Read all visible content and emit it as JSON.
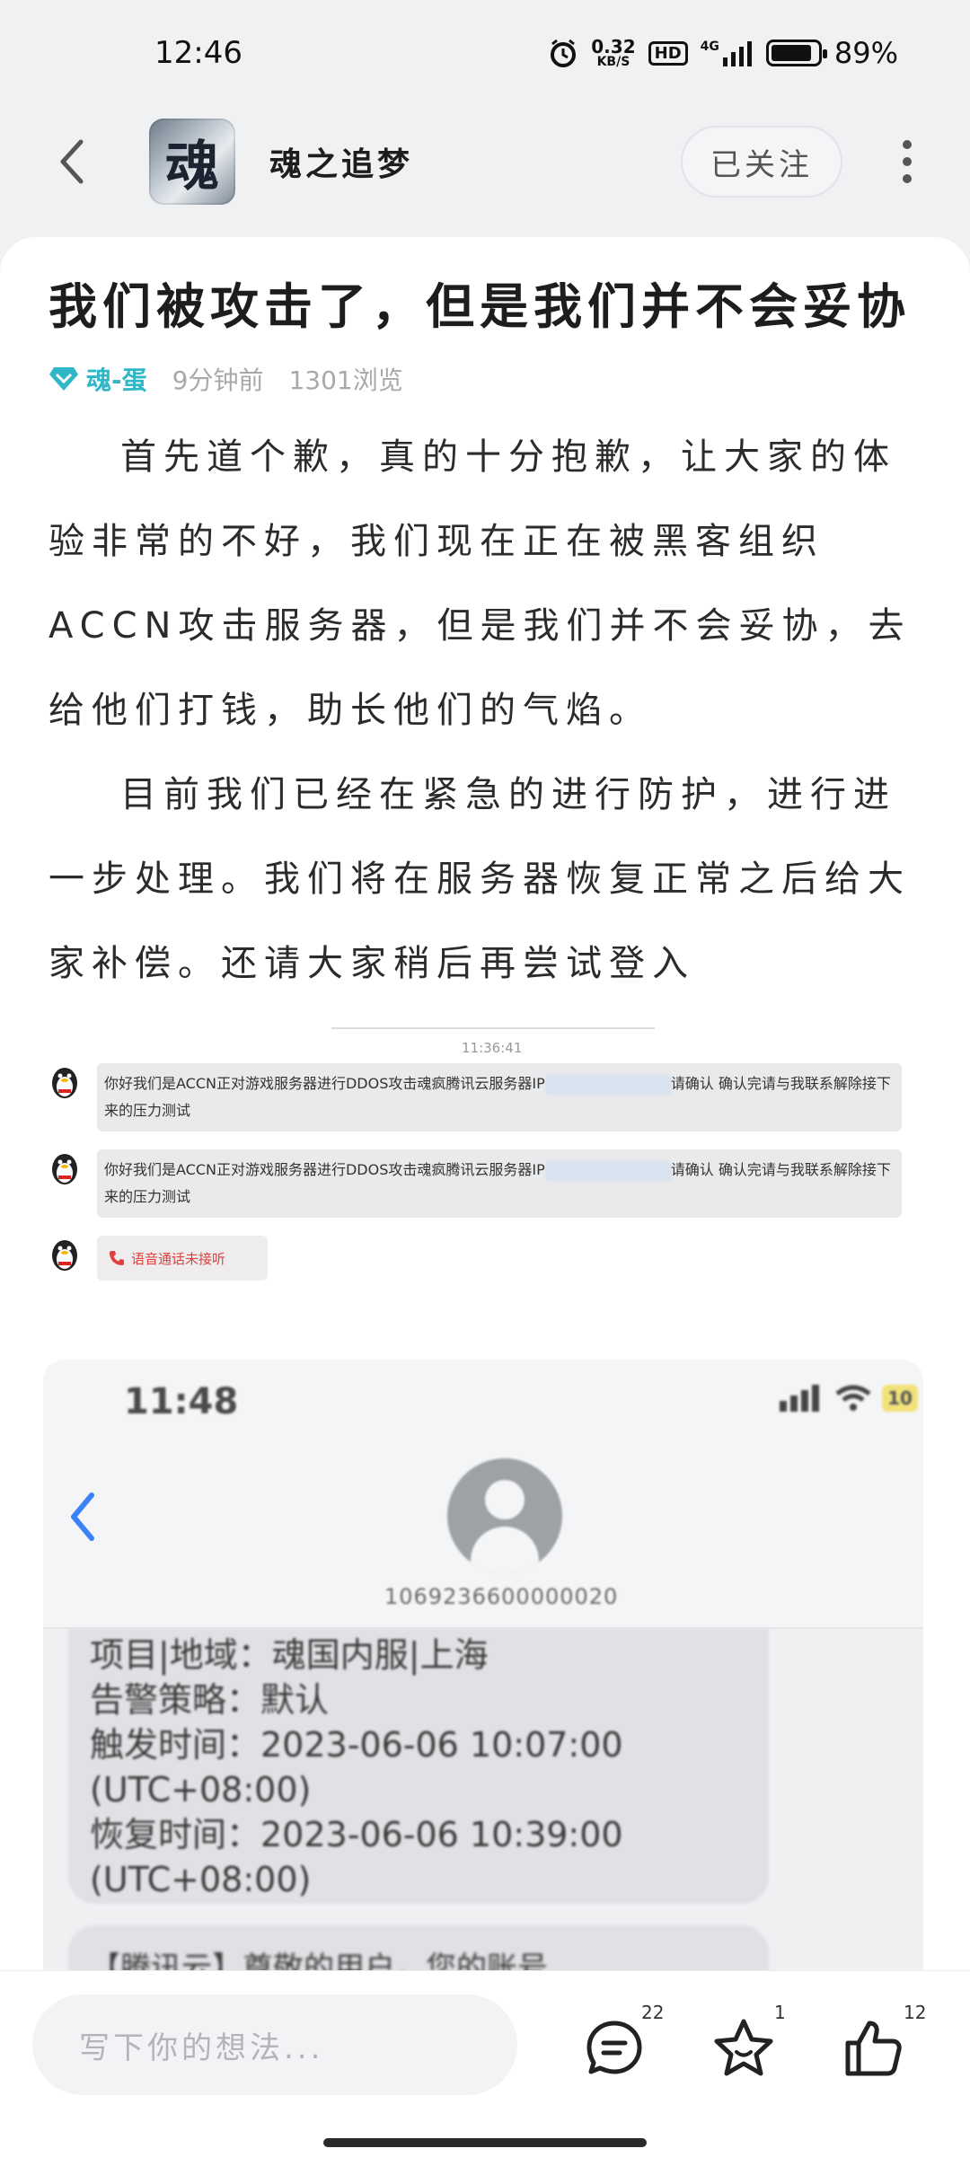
{
  "status_bar": {
    "time": "12:46",
    "net_speed_value": "0.32",
    "net_speed_unit": "KB/S",
    "hd_label": "HD",
    "network_label": "4G",
    "battery_percent": "89%",
    "battery_level": 0.89,
    "icons": [
      "alarm-icon",
      "signal-icon",
      "battery-icon"
    ]
  },
  "header": {
    "app_logo_char": "魂",
    "app_name": "魂之追梦",
    "follow_label": "已关注"
  },
  "post": {
    "title": "我们被攻击了，但是我们并不会妥协",
    "author": "魂-蛋",
    "time_ago": "9分钟前",
    "views": "1301浏览",
    "paragraphs": [
      "首先道个歉，真的十分抱歉，让大家的体验非常的不好，我们现在正在被黑客组织ACCN攻击服务器，但是我们并不会妥协，去给他们打钱，助长他们的气焰。",
      "目前我们已经在紧急的进行防护，进行进一步处理。我们将在服务器恢复正常之后给大家补偿。还请大家稍后再尝试登入"
    ]
  },
  "chat_screenshot": {
    "timestamp": "11:36:41",
    "messages": [
      {
        "pre": "你好我们是ACCN正对游戏服务器进行DDOS攻击魂疯腾讯云服务器IP",
        "post": "请确认 确认完请与我联系解除接下来的压力测试"
      },
      {
        "pre": "你好我们是ACCN正对游戏服务器进行DDOS攻击魂疯腾讯云服务器IP",
        "post": "请确认 确认完请与我联系解除接下来的压力测试"
      }
    ],
    "call_label": "语音通话未接听"
  },
  "sms_screenshot": {
    "time": "11:48",
    "battery_label": "10",
    "sender": "1069236600000020",
    "body": "项目|地域：魂国内服|上海\n告警策略：默认\n触发时间：2023-06-06 10:07:00\n(UTC+08:00)\n恢复时间：2023-06-06 10:39:00\n(UTC+08:00)",
    "next_message": "【腾讯云】尊敬的用户，您的账号"
  },
  "bottom_bar": {
    "comment_placeholder": "写下你的想法...",
    "comment_count": "22",
    "favorite_count": "1",
    "like_count": "12"
  },
  "colors": {
    "accent": "#2fb7c8",
    "background": "#f0f1f3",
    "card": "#ffffff",
    "missed_call": "#e04040"
  }
}
